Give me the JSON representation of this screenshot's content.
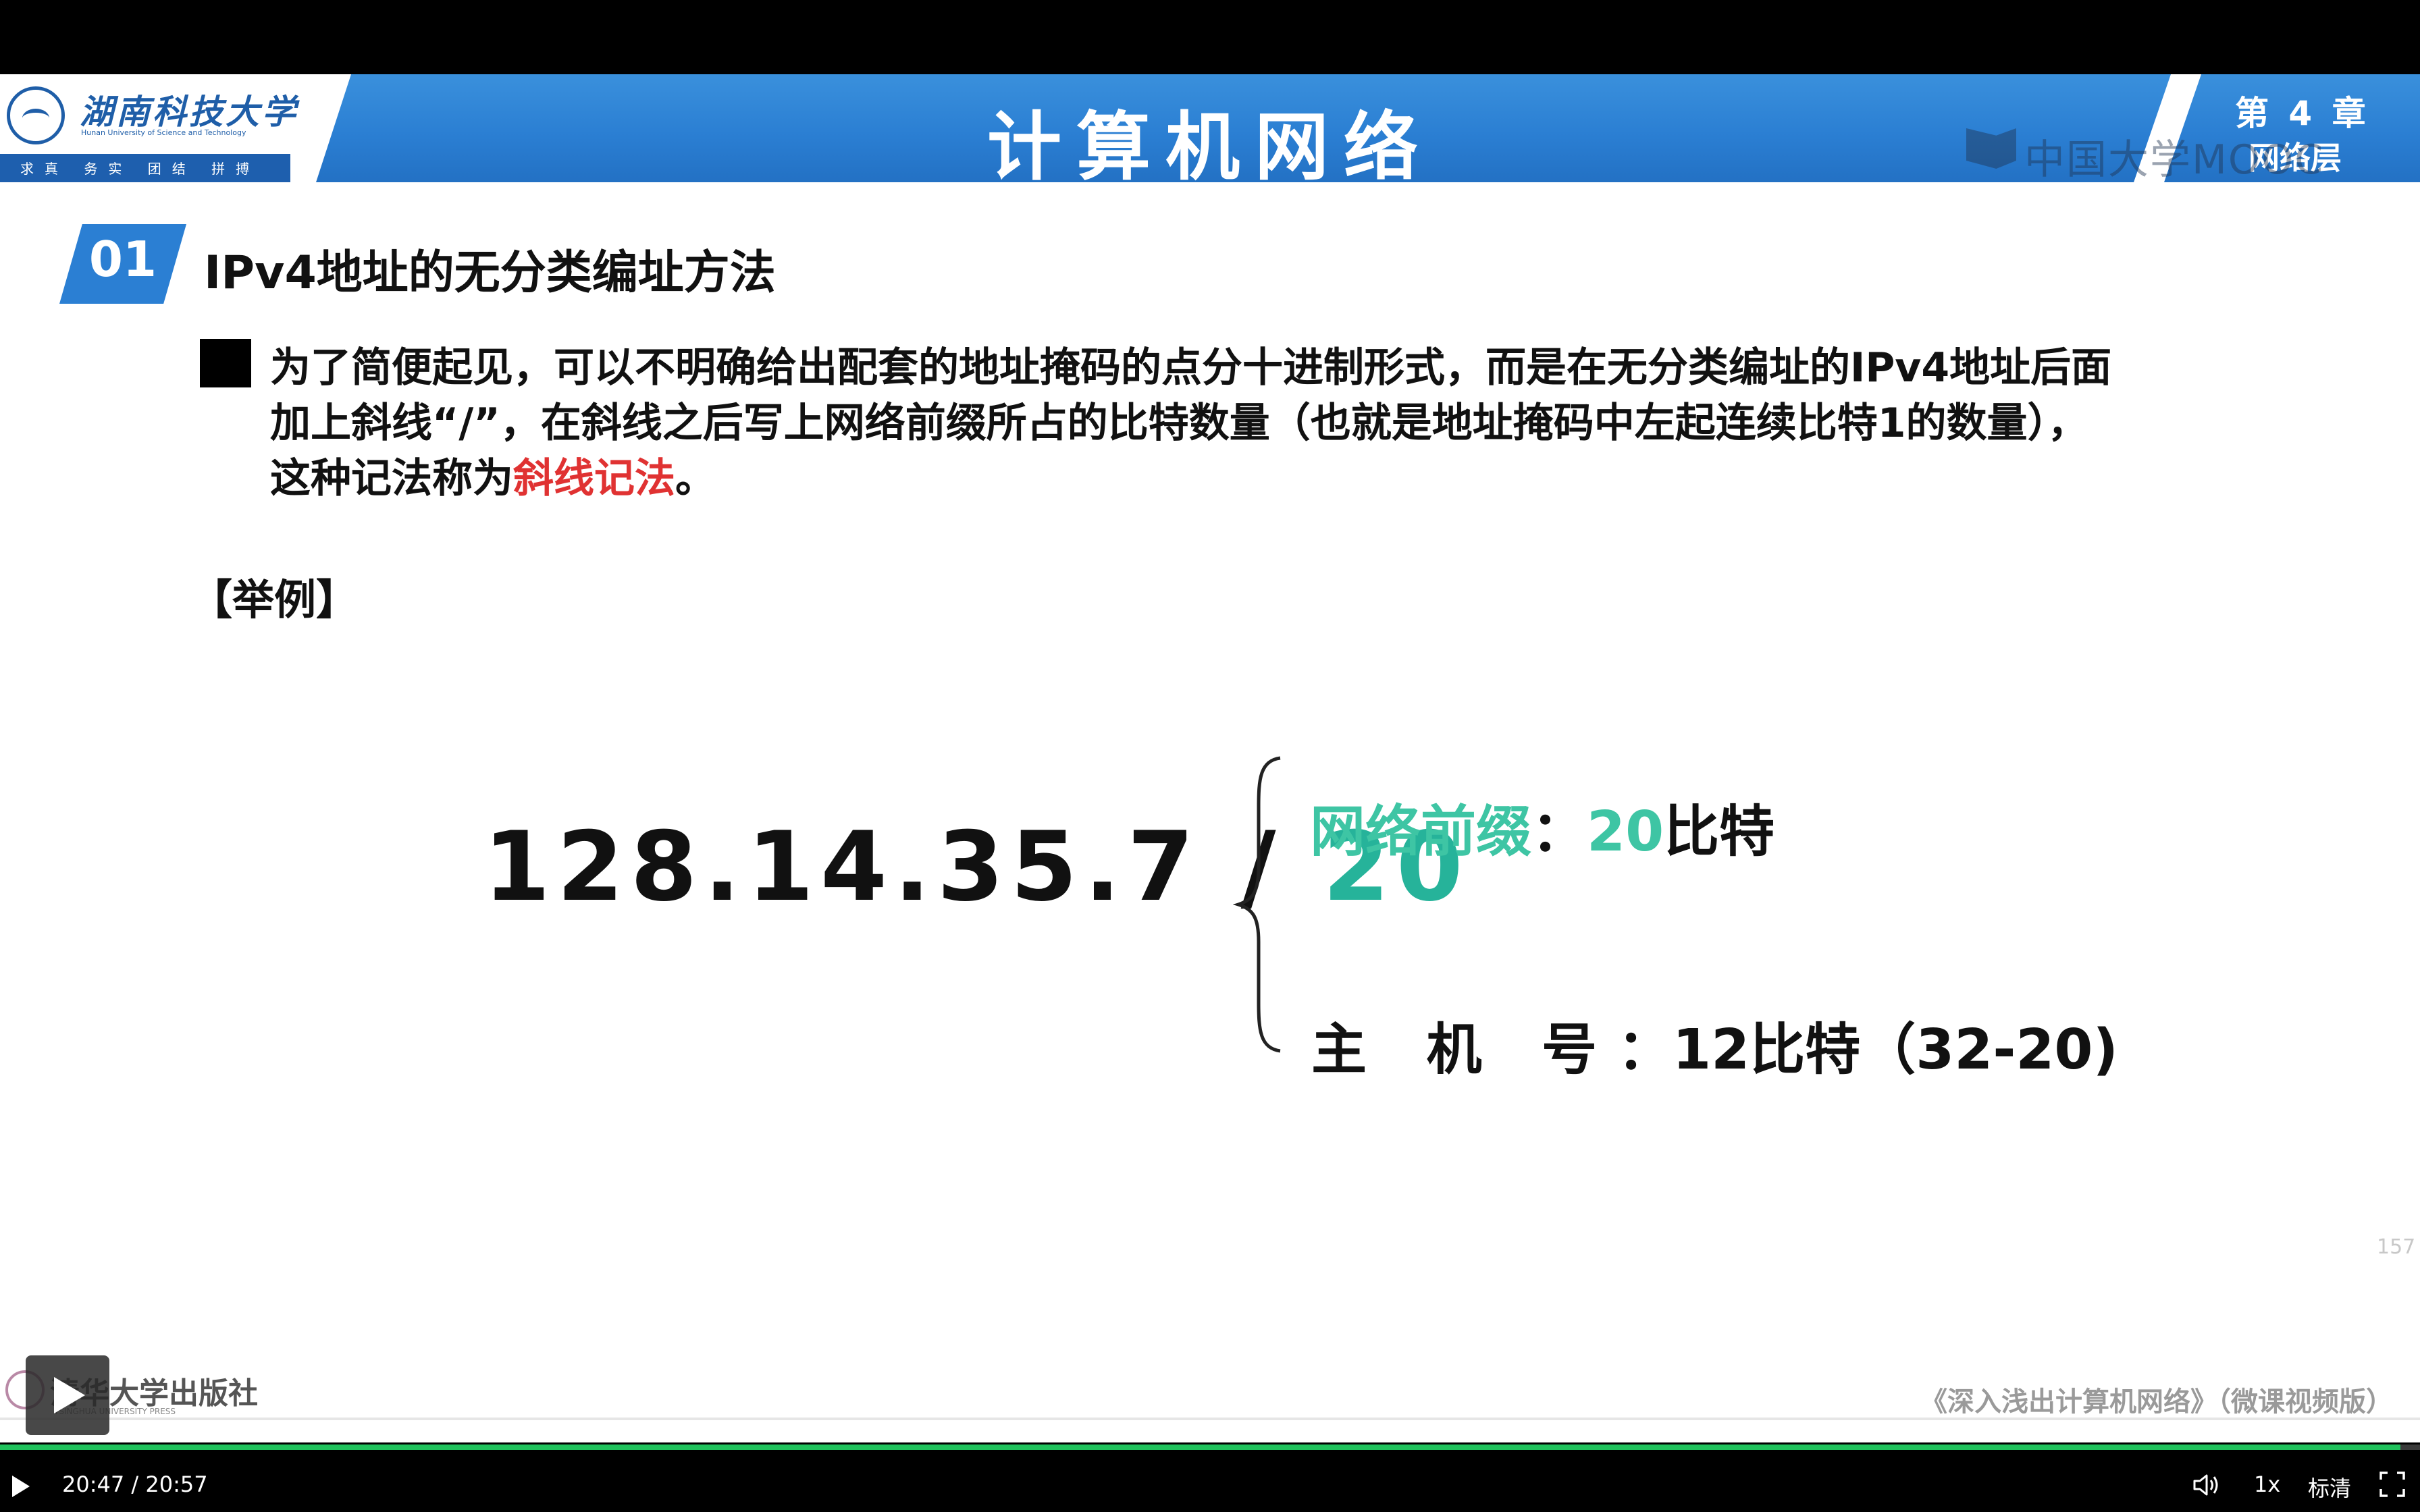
{
  "slide": {
    "university_cn": "湖南科技大学",
    "university_en": "Hunan University of Science and Technology",
    "motto": "求真 务实 团结 拼搏",
    "title": "计算机网络",
    "chapter": "第 4 章",
    "chapter_sub": "网络层",
    "watermark": "中国大学MOOC",
    "section_number": "01",
    "section_title": "IPv4地址的无分类编址方法",
    "paragraph": {
      "line1": "为了简便起见，可以不明确给出配套的地址掩码的点分十进制形式，而是在无分类编址的IPv4地址后面",
      "line2": "加上斜线“/”，在斜线之后写上网络前缀所占的比特数量（也就是地址掩码中左起连续比特1的数量），",
      "line3_prefix": "这种记法称为",
      "line3_highlight": "斜线记法",
      "line3_suffix": "。"
    },
    "example_label": "【举例】",
    "address": "128.14.35.7 / ",
    "prefix_len": "20",
    "network": {
      "label": "网络前缀",
      "colon": "：",
      "bits": "20",
      "unit": "比特"
    },
    "host": {
      "label": "主 机 号",
      "colon": "：",
      "value": "12比特（32-20)"
    },
    "page_mark": "157",
    "publisher": "清华大学出版社",
    "publisher_en": "TSINGHUA UNIVERSITY PRESS",
    "book": "《深入浅出计算机网络》（微课视频版）"
  },
  "player": {
    "current_time": "20:47",
    "separator": "/",
    "duration": "20:57",
    "progress": 0.992,
    "speed": "1x",
    "quality": "标清",
    "accent_color": "#20c25c"
  }
}
